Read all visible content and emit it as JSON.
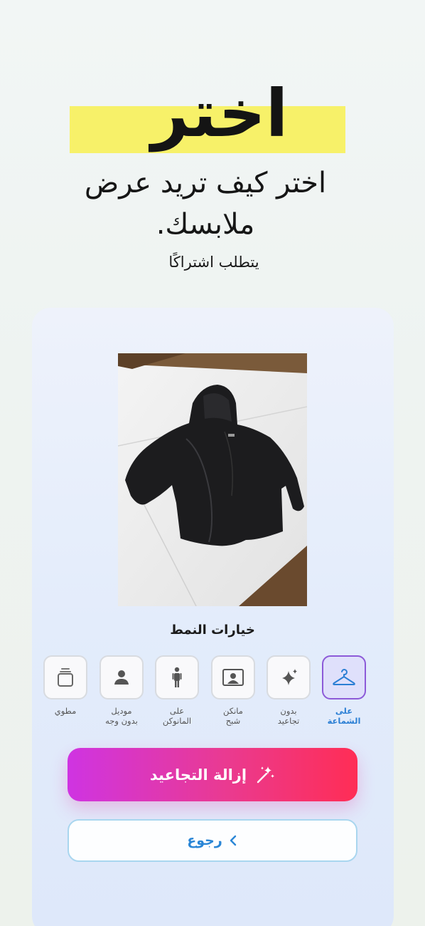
{
  "hero": {
    "headline": "اختر",
    "subtitle": "اختر كيف تريد عرض ملابسك.",
    "note": "يتطلب اشتراكًا"
  },
  "style_options": {
    "title": "خيارات النمط",
    "items": [
      {
        "label": "على\nالشماعة",
        "icon": "hanger-icon",
        "selected": true
      },
      {
        "label": "بدون\nتجاعيد",
        "icon": "sparkle-icon",
        "selected": false
      },
      {
        "label": "مانكن\nشبح",
        "icon": "portrait-frame-icon",
        "selected": false
      },
      {
        "label": "على\nالمانوكن",
        "icon": "mannequin-icon",
        "selected": false
      },
      {
        "label": "موديل\nبدون وجه",
        "icon": "person-icon",
        "selected": false
      },
      {
        "label": "مطوي",
        "icon": "folded-stack-icon",
        "selected": false
      }
    ]
  },
  "actions": {
    "primary_label": "إزالة التجاعيد",
    "back_label": "رجوع"
  },
  "colors": {
    "highlight": "#f7f169",
    "accent_blue": "#2b7fd4",
    "gradient_start": "#cf34e2",
    "gradient_end": "#ff2d55"
  }
}
